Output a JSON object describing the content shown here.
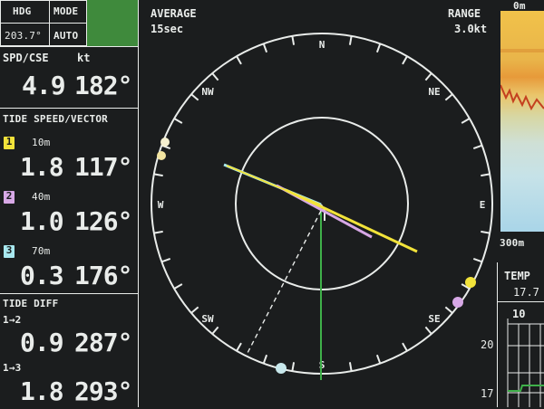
{
  "header": {
    "hdg_label": "HDG",
    "hdg_value": "203.7°",
    "mode_label": "MODE",
    "mode_value": "AUTO",
    "average_label": "AVERAGE",
    "average_value": "15sec",
    "range_label": "RANGE",
    "range_value": "3.0kt"
  },
  "speed": {
    "label": "SPD/CSE",
    "unit": "kt",
    "speed": "4.9",
    "course": "182°"
  },
  "tide": {
    "title": "TIDE SPEED/VECTOR",
    "layers": [
      {
        "num": "1",
        "depth": "10m",
        "speed": "1.8",
        "dir": "117°",
        "color": "#f2e33a"
      },
      {
        "num": "2",
        "depth": "40m",
        "speed": "1.0",
        "dir": "126°",
        "color": "#d7a8e6"
      },
      {
        "num": "3",
        "depth": "70m",
        "speed": "0.3",
        "dir": "176°",
        "color": "#a8e8ef"
      }
    ]
  },
  "tide_diff": {
    "title": "TIDE DIFF",
    "rows": [
      {
        "label": "1→2",
        "speed": "0.9",
        "dir": "287°"
      },
      {
        "label": "1→3",
        "speed": "1.8",
        "dir": "293°"
      }
    ]
  },
  "compass": {
    "labels": {
      "N": "N",
      "NE": "NE",
      "E": "E",
      "SE": "SE",
      "S": "S",
      "SW": "SW",
      "W": "W",
      "NW": "NW"
    }
  },
  "sounder": {
    "top_label": "0m",
    "bottom_label": "300m"
  },
  "temp": {
    "label": "TEMP",
    "value": "17.7",
    "graph_top": "10",
    "scale_20": "20",
    "scale_17": "17"
  },
  "colors": {
    "bg": "#1b1d1e",
    "fg": "#e9ecea",
    "mode_block": "#3f8a3c",
    "heading_line": "#3fb04a",
    "vector_1": "#f2e33a",
    "vector_2": "#d7a8e6",
    "vector_3": "#a8e8ef"
  }
}
